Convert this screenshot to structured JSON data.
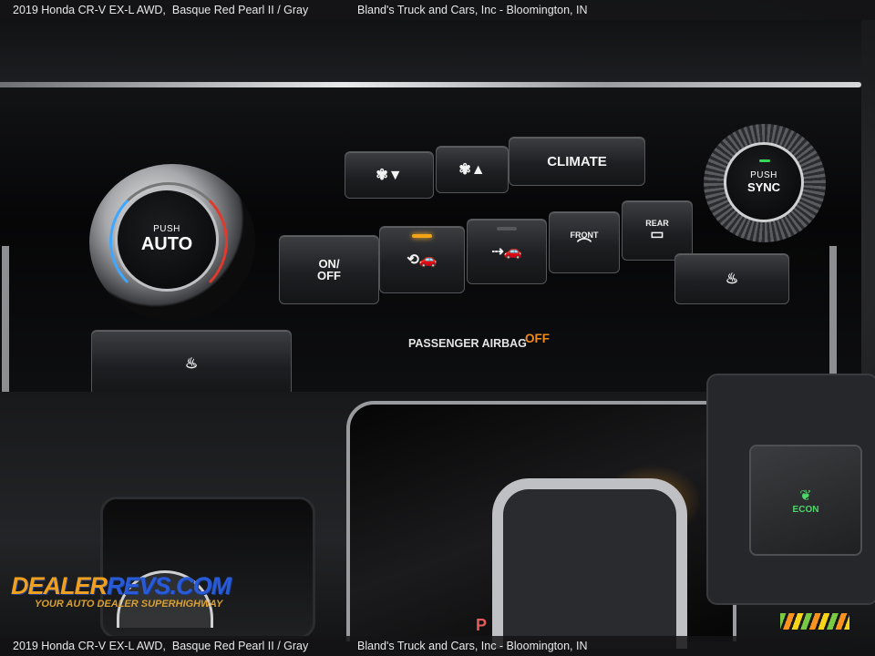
{
  "caption": {
    "vehicle": "2019 Honda CR-V EX-L AWD,",
    "color": "Basque Red Pearl II / Gray",
    "dealer": "Bland's Truck and Cars, Inc - Bloomington, IN"
  },
  "climate_panel": {
    "left_knob": {
      "top": "PUSH",
      "bottom": "AUTO"
    },
    "right_knob": {
      "top": "PUSH",
      "bottom": "SYNC"
    },
    "climate_button": "CLIMATE",
    "onoff_button": {
      "line1": "ON/",
      "line2": "OFF"
    },
    "front_button": "FRONT",
    "rear_button": "REAR",
    "recirc_indicator": "on",
    "airbag_label": "PASSENGER AIRBAG",
    "airbag_state": "OFF"
  },
  "console": {
    "econ_label": "ECON",
    "gear_label": "P"
  },
  "watermark": {
    "brand_part1": "DEALER",
    "brand_part2": "REVS",
    "brand_part3": ".COM",
    "tagline": "YOUR AUTO DEALER SUPERHIGHWAY"
  },
  "colors": {
    "indicator_on": "#f2a316",
    "econ_green": "#4fd66a",
    "airbag_orange": "#f08a1e"
  }
}
